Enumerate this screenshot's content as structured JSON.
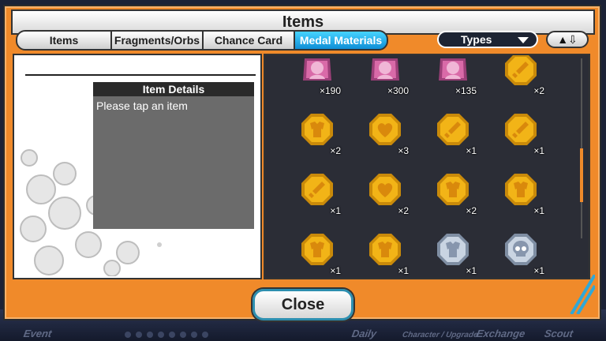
{
  "dialog": {
    "title": "Items"
  },
  "tabs": [
    {
      "label": "Items",
      "active": false
    },
    {
      "label": "Fragments/Orbs",
      "active": false
    },
    {
      "label": "Chance Card",
      "active": false
    },
    {
      "label": "Medal Materials",
      "active": true
    }
  ],
  "filter": {
    "types_label": "Types",
    "sort_icon": "sort-up-down-icon"
  },
  "details": {
    "heading": "Item Details",
    "placeholder": "Please tap an item"
  },
  "items": [
    {
      "kind": "pink-medal",
      "icon": "character-medal-icon",
      "qty": "×190"
    },
    {
      "kind": "pink-medal",
      "icon": "character-medal-icon",
      "qty": "×300"
    },
    {
      "kind": "pink-medal",
      "icon": "character-medal-icon",
      "qty": "×135"
    },
    {
      "kind": "gold",
      "icon": "sword-icon",
      "qty": "×2"
    },
    {
      "kind": "gold",
      "icon": "armor-icon",
      "qty": "×2"
    },
    {
      "kind": "gold",
      "icon": "heart-icon",
      "qty": "×3"
    },
    {
      "kind": "gold",
      "icon": "sword-icon",
      "qty": "×1"
    },
    {
      "kind": "gold",
      "icon": "sword-icon",
      "qty": "×1"
    },
    {
      "kind": "gold",
      "icon": "sword-icon",
      "qty": "×1"
    },
    {
      "kind": "gold",
      "icon": "heart-icon",
      "qty": "×2"
    },
    {
      "kind": "gold",
      "icon": "armor-icon",
      "qty": "×2"
    },
    {
      "kind": "gold",
      "icon": "armor-icon",
      "qty": "×1"
    },
    {
      "kind": "gold",
      "icon": "armor-icon",
      "qty": "×1"
    },
    {
      "kind": "gold",
      "icon": "armor-icon",
      "qty": "×1"
    },
    {
      "kind": "silver",
      "icon": "armor-icon",
      "qty": "×1"
    },
    {
      "kind": "silver",
      "icon": "skull-icon",
      "qty": "×1"
    }
  ],
  "close": {
    "label": "Close"
  },
  "background_nav": [
    "Event",
    "Daily",
    "Character / Upgrade",
    "Exchange",
    "Scout"
  ],
  "colors": {
    "frame": "#f08a2a",
    "active_tab": "#1a9de0",
    "gold": "#f2b417",
    "silver": "#b9c6d6",
    "pink": "#d96aa8"
  }
}
